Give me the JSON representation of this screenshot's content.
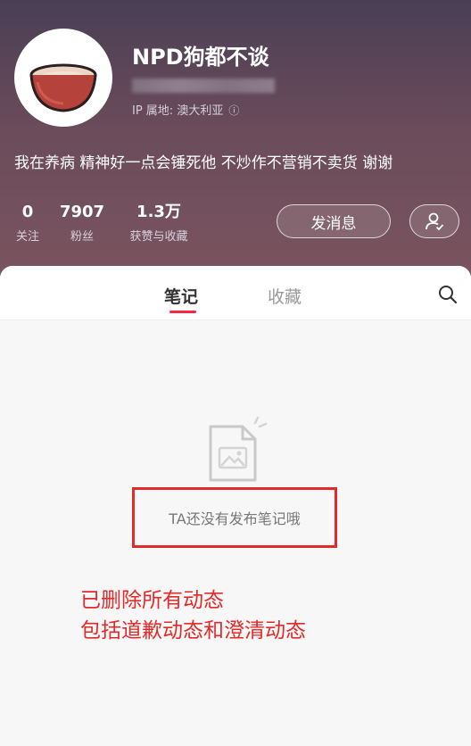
{
  "profile": {
    "username": "NPD狗都不谈",
    "ip_location": "IP 属地: 澳大利亚",
    "bio": "我在养病 精神好一点会锤死他 不炒作不营销不卖货 谢谢",
    "avatar_icon": "bowl-icon"
  },
  "stats": {
    "following_count": "0",
    "following_label": "关注",
    "followers_count": "7907",
    "followers_label": "粉丝",
    "likes_count": "1.3万",
    "likes_label": "获赞与收藏"
  },
  "actions": {
    "message_label": "发消息",
    "user_icon": "user-check-icon"
  },
  "tabs": [
    {
      "label": "笔记",
      "active": true
    },
    {
      "label": "收藏",
      "active": false
    }
  ],
  "empty_state": {
    "text": "TA还没有发布笔记哦",
    "icon": "empty-image-doc-icon"
  },
  "annotation": {
    "line1": "已删除所有动态",
    "line2": "包括道歉动态和澄清动态",
    "color": "#e32a2a"
  },
  "colors": {
    "accent": "#ff2442",
    "header_gradient_top": "#4a3f55",
    "header_gradient_bottom": "#7b5560"
  }
}
